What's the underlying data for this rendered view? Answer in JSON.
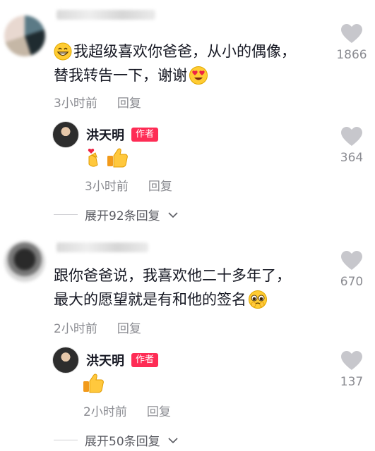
{
  "comments": [
    {
      "text_line1": "我超级喜欢你爸爸，从小的偶像，",
      "text_line2": "替我转告一下，谢谢",
      "time": "3小时前",
      "reply_label": "回复",
      "likes": "1866",
      "reply": {
        "author": "洪天明",
        "author_tag": "作者",
        "time": "3小时前",
        "reply_label": "回复",
        "likes": "364"
      },
      "expand_label": "展开92条回复"
    },
    {
      "text_line1": "跟你爸爸说，我喜欢他二十多年了，",
      "text_line2": "最大的愿望就是有和他的签名",
      "time": "2小时前",
      "reply_label": "回复",
      "likes": "670",
      "reply": {
        "author": "洪天明",
        "author_tag": "作者",
        "time": "2小时前",
        "reply_label": "回复",
        "likes": "137"
      },
      "expand_label": "展开50条回复"
    }
  ],
  "colors": {
    "text": "#161823",
    "meta": "#8a8b91",
    "author_tag": "#fe2c55",
    "like_icon": "#c7c7cc"
  },
  "icons": [
    "heart-icon",
    "chevron-down-icon",
    "grin-emoji-icon",
    "heart-eyes-emoji-icon",
    "finger-heart-emoji-icon",
    "thumbs-up-emoji-icon",
    "pleading-emoji-icon"
  ]
}
